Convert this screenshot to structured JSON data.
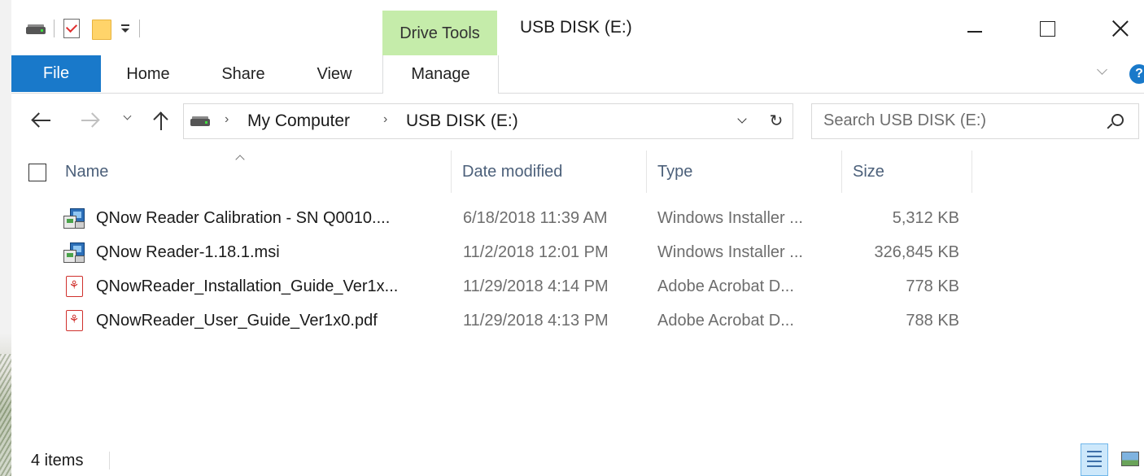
{
  "window": {
    "title": "USB DISK (E:)",
    "contextual_tab_group": "Drive Tools"
  },
  "quick_access_toolbar": {
    "icons": [
      "drive-icon",
      "properties-icon",
      "new-folder-icon",
      "customize-dropdown-icon"
    ]
  },
  "ribbon": {
    "tabs": [
      {
        "label": "File",
        "active": false,
        "accent": "#1979ca"
      },
      {
        "label": "Home"
      },
      {
        "label": "Share"
      },
      {
        "label": "View"
      },
      {
        "label": "Manage",
        "selected": true
      }
    ],
    "contextual_color": "#c5ecaa"
  },
  "address": {
    "breadcrumbs": [
      "My Computer",
      "USB DISK (E:)"
    ]
  },
  "search": {
    "placeholder": "Search USB DISK (E:)"
  },
  "columns": {
    "name": "Name",
    "date": "Date modified",
    "type": "Type",
    "size": "Size"
  },
  "files": [
    {
      "icon": "msi-installer-icon",
      "name": "QNow Reader Calibration - SN Q0010....",
      "date": "6/18/2018 11:39 AM",
      "type": "Windows Installer ...",
      "size": "5,312 KB"
    },
    {
      "icon": "msi-installer-icon",
      "name": "QNow Reader-1.18.1.msi",
      "date": "11/2/2018 12:01 PM",
      "type": "Windows Installer ...",
      "size": "326,845 KB"
    },
    {
      "icon": "pdf-icon",
      "name": "QNowReader_Installation_Guide_Ver1x...",
      "date": "11/29/2018 4:14 PM",
      "type": "Adobe Acrobat D...",
      "size": "778 KB"
    },
    {
      "icon": "pdf-icon",
      "name": "QNowReader_User_Guide_Ver1x0.pdf",
      "date": "11/29/2018 4:13 PM",
      "type": "Adobe Acrobat D...",
      "size": "788 KB"
    }
  ],
  "status": {
    "item_count": "4 items"
  }
}
